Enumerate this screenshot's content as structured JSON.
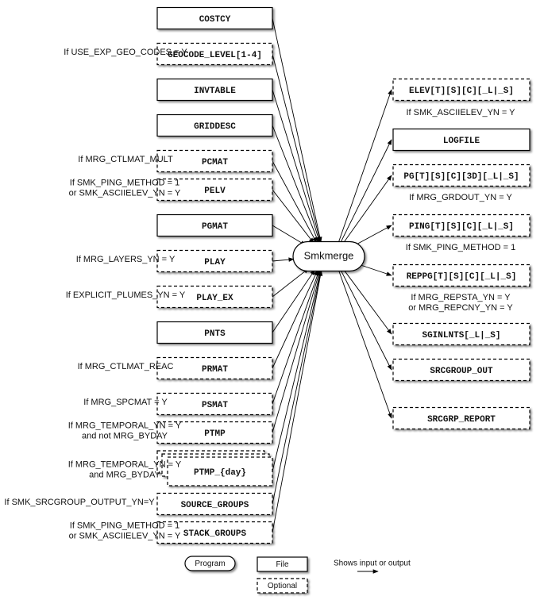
{
  "program": {
    "label": "Smkmerge"
  },
  "inputs": [
    {
      "label": "COSTCY",
      "optional": false,
      "condition": []
    },
    {
      "label": "GEOCODE_LEVEL[1-4]",
      "optional": true,
      "condition": [
        "If USE_EXP_GEO_CODES = Y"
      ]
    },
    {
      "label": "INVTABLE",
      "optional": false,
      "condition": []
    },
    {
      "label": "GRIDDESC",
      "optional": false,
      "condition": []
    },
    {
      "label": "PCMAT",
      "optional": true,
      "condition": [
        "If MRG_CTLMAT_MULT"
      ]
    },
    {
      "label": "PELV",
      "optional": true,
      "condition": [
        "If SMK_PING_METHOD = 1",
        "or SMK_ASCIIELEV_YN = Y"
      ]
    },
    {
      "label": "PGMAT",
      "optional": false,
      "condition": []
    },
    {
      "label": "PLAY",
      "optional": true,
      "condition": [
        "If MRG_LAYERS_YN = Y"
      ]
    },
    {
      "label": "PLAY_EX",
      "optional": true,
      "condition": [
        "If EXPLICIT_PLUMES_YN = Y"
      ]
    },
    {
      "label": "PNTS",
      "optional": false,
      "condition": []
    },
    {
      "label": "PRMAT",
      "optional": true,
      "condition": [
        "If MRG_CTLMAT_REAC"
      ]
    },
    {
      "label": "PSMAT",
      "optional": true,
      "condition": [
        "If MRG_SPCMAT = Y"
      ]
    },
    {
      "label": "PTMP",
      "optional": true,
      "condition": [
        "If MRG_TEMPORAL_YN = Y",
        "and not MRG_BYDAY"
      ]
    },
    {
      "label": "PTMP_{day}",
      "optional": true,
      "stacked": true,
      "condition": [
        "If MRG_TEMPORAL_YN = Y",
        "and MRG_BYDAY"
      ]
    },
    {
      "label": "SOURCE_GROUPS",
      "optional": true,
      "condition": [
        "If SMK_SRCGROUP_OUTPUT_YN=Y"
      ]
    },
    {
      "label": "STACK_GROUPS",
      "optional": true,
      "condition": [
        "If SMK_PING_METHOD = 1",
        "or SMK_ASCIIELEV_YN = Y"
      ]
    }
  ],
  "outputs": [
    {
      "label": "ELEV[T][S][C][_L|_S]",
      "optional": true,
      "condition": [
        "If SMK_ASCIIELEV_YN = Y"
      ]
    },
    {
      "label": "LOGFILE",
      "optional": false,
      "condition": []
    },
    {
      "label": "PG[T][S][C][3D][_L|_S]",
      "optional": true,
      "condition": [
        "If MRG_GRDOUT_YN = Y"
      ]
    },
    {
      "label": "PING[T][S][C][_L|_S]",
      "optional": true,
      "condition": [
        "If SMK_PING_METHOD = 1"
      ]
    },
    {
      "label": "REPPG[T][S][C][_L|_S]",
      "optional": true,
      "condition": [
        "If MRG_REPSTA_YN = Y",
        "or MRG_REPCNY_YN = Y"
      ]
    },
    {
      "label": "SGINLNTS[_L|_S]",
      "optional": true,
      "condition": []
    },
    {
      "label": "SRCGROUP_OUT",
      "optional": true,
      "condition": []
    },
    {
      "label": "SRCGRP_REPORT",
      "optional": true,
      "condition": []
    }
  ],
  "legend": {
    "program": "Program",
    "file": "File",
    "optional": "Optional",
    "arrow": "Shows input or output"
  }
}
